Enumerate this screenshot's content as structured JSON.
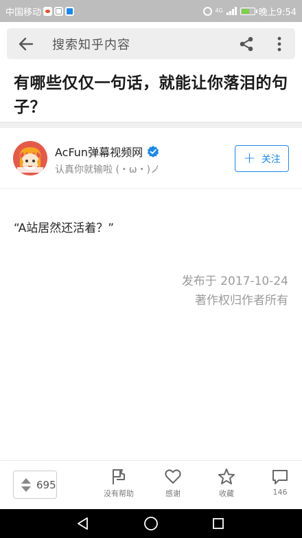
{
  "status_bar": {
    "carrier": "中国移动",
    "time": "晚上9:54",
    "network_label": "4G",
    "battery_color": "#7bd148"
  },
  "top_bar": {
    "search_placeholder": "搜索知乎内容",
    "icons": [
      "arrow-left-icon",
      "share-icon",
      "more-vertical-icon"
    ]
  },
  "question": {
    "title": "有哪些仅仅一句话，就能让你落泪的句子？"
  },
  "author": {
    "name": "AcFun弹幕视频网",
    "bio": "认真你就输啦 (・ω・)ノ",
    "verified_color": "#1e88e5",
    "follow_label": "关注"
  },
  "answer": {
    "content": "“A站居然还活着？”",
    "published": "发布于 2017-10-24",
    "copyright": "著作权归作者所有"
  },
  "actions": {
    "vote_count": "695",
    "not_helpful": "没有帮助",
    "thanks": "感谢",
    "collect": "收藏",
    "comments": "146"
  },
  "colors": {
    "accent": "#1e88e5",
    "status_bar_bg": "#bdbdbd",
    "nav_bar_bg": "#000000"
  }
}
